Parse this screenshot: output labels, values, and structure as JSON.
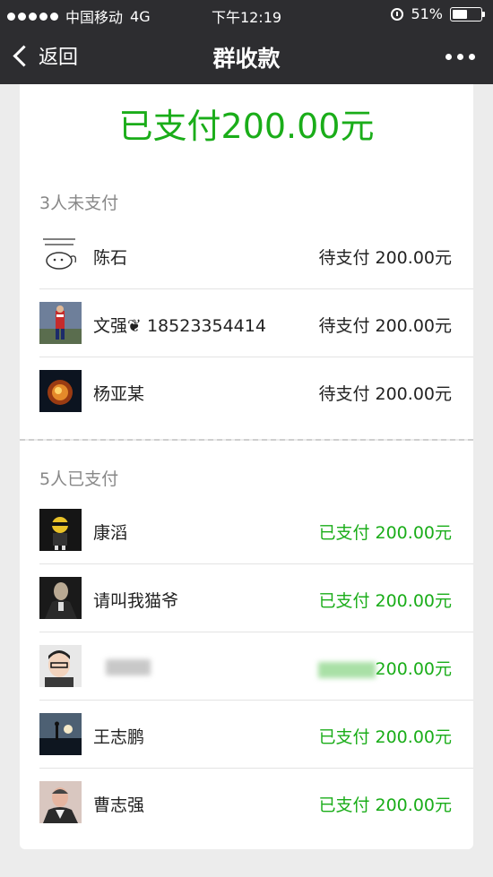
{
  "statusbar": {
    "carrier": "中国移动",
    "network": "4G",
    "time": "下午12:19",
    "battery": "51%"
  },
  "nav": {
    "back_label": "返回",
    "title": "群收款"
  },
  "total": "已支付200.00元",
  "unpaid": {
    "title": "3人未支付",
    "rows": [
      {
        "name": "陈石",
        "status": "待支付 200.00元"
      },
      {
        "name": "文强❦ 18523354414",
        "status": "待支付 200.00元"
      },
      {
        "name": "杨亚某",
        "status": "待支付 200.00元"
      }
    ]
  },
  "paid": {
    "title": "5人已支付",
    "rows": [
      {
        "name": "康滔",
        "status": "已支付 200.00元"
      },
      {
        "name": "请叫我猫爷",
        "status": "已支付 200.00元"
      },
      {
        "name": "",
        "status": "200.00元"
      },
      {
        "name": "王志鹏",
        "status": "已支付 200.00元"
      },
      {
        "name": "曹志强",
        "status": "已支付 200.00元"
      }
    ]
  },
  "colors": {
    "accent": "#1aad19",
    "bar": "#2d2d30"
  }
}
